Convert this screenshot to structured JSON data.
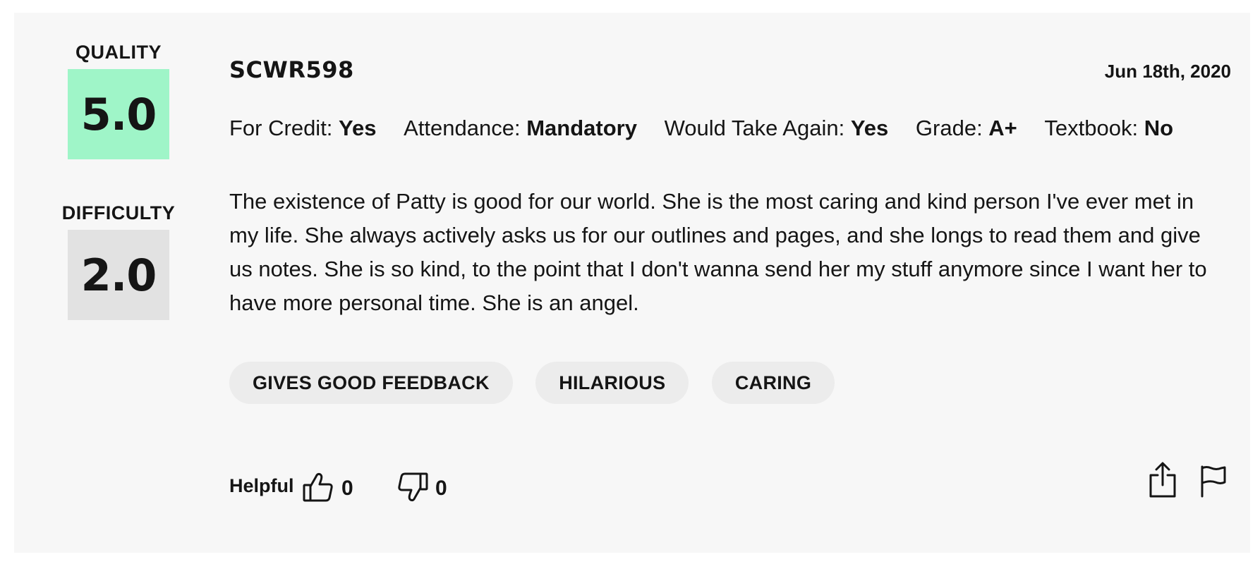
{
  "ratings": {
    "quality_label": "QUALITY",
    "quality_value": "5.0",
    "difficulty_label": "DIFFICULTY",
    "difficulty_value": "2.0",
    "quality_color": "#9ff5c8",
    "difficulty_color": "#e2e2e2"
  },
  "review": {
    "course": "SCWR598",
    "date": "Jun 18th, 2020",
    "meta": [
      {
        "label": "For Credit: ",
        "value": "Yes"
      },
      {
        "label": "Attendance: ",
        "value": "Mandatory"
      },
      {
        "label": "Would Take Again: ",
        "value": "Yes"
      },
      {
        "label": "Grade: ",
        "value": "A+"
      },
      {
        "label": "Textbook: ",
        "value": "No"
      }
    ],
    "comment": "The existence of Patty is good for our world. She is the most caring and kind person I've ever met in my life. She always actively asks us for our outlines and pages, and she longs to read them and give us notes. She is so kind, to the point that I don't wanna send her my stuff anymore since I want her to have more personal time. She is an angel.",
    "tags": [
      "GIVES GOOD FEEDBACK",
      "HILARIOUS",
      "CARING"
    ]
  },
  "footer": {
    "helpful_label": "Helpful",
    "thumbs_up_count": "0",
    "thumbs_down_count": "0",
    "icons": [
      "thumbs-up-icon",
      "thumbs-down-icon",
      "share-icon",
      "flag-icon"
    ]
  }
}
